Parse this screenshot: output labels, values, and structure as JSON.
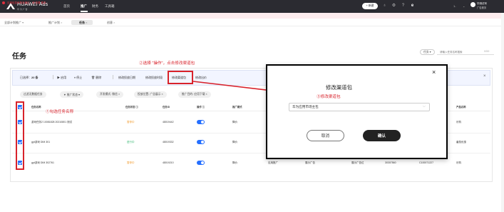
{
  "app": {
    "brand": "HUAWEI Ads",
    "brand_sub": "华 为 广 告",
    "nav": [
      "首页",
      "推广",
      "财务",
      "工具箱"
    ],
    "create_label": "+ 新建",
    "user_name": "1-",
    "account_line1": "华测试号",
    "account_line2": "广告服务"
  },
  "notice": {
    "text": "应用信息审核未通过，请 查看 更多..."
  },
  "tabs": [
    {
      "label": "全部计划推广"
    },
    {
      "label": "推广计划"
    },
    {
      "label": "任务"
    },
    {
      "label": "创意"
    }
  ],
  "page": {
    "title": "任务",
    "task_select": "任务",
    "search_placeholder": "请输入任务名称搜索",
    "search_count": "0/59"
  },
  "selection_bar": {
    "selected_prefix": "已选择：",
    "selected_count": "20 条",
    "actions": [
      "▶ 启用",
      "⏸ 停止",
      "🗑 删除",
      "修改投放日期",
      "修改投放时段",
      "修改渠道包",
      "修改出价"
    ],
    "close": "×"
  },
  "filters": [
    "过滤无数据任务",
    "▼ 推广状态 ▾",
    "开发模式: 微信 ×",
    "投放位置: 广告展示 ×",
    "推广目的: 应用下载 ×"
  ],
  "table": {
    "headers": [
      "任务名称",
      "任务状态 ⓘ",
      "任务ID",
      "操作 ⓘ",
      "推广模式",
      "投放位置",
      "产品名称"
    ],
    "rows": [
      {
        "name": "游戏任务2 10081828 20210801 测试",
        "status": "暂停中",
        "id": "48019442",
        "mode": "降价",
        "product": "乐购"
      },
      {
        "name": "gpt游戏 DIM 301",
        "status": "进行中",
        "id": "48019332",
        "mode": "降价",
        "product": "番茄优惠"
      },
      {
        "name": "gpt游戏 DIM 302761",
        "status": "暂停中",
        "id": "48019210",
        "mode": "降价",
        "extra1": "应用推广",
        "extra2": "展示广告",
        "extra3": "展示广告位",
        "extra4": "30307560",
        "extra5": "C100071227",
        "product": "乐购"
      }
    ]
  },
  "annotations": {
    "step1": "①勾选任务名称",
    "step2": "②选择 \"操作\"，点击修改渠道包",
    "step3": "③修改渠道包"
  },
  "dialog": {
    "title": "修改渠道包",
    "close": "×",
    "channel_value": "华为应用市场主包",
    "caret": "⌵",
    "cancel": "取消",
    "confirm": "确认"
  },
  "colors": {
    "topbar": "#2b2b31",
    "accent": "#256fff",
    "annotation": "#d8222b",
    "status_orange": "#f19a2b"
  }
}
